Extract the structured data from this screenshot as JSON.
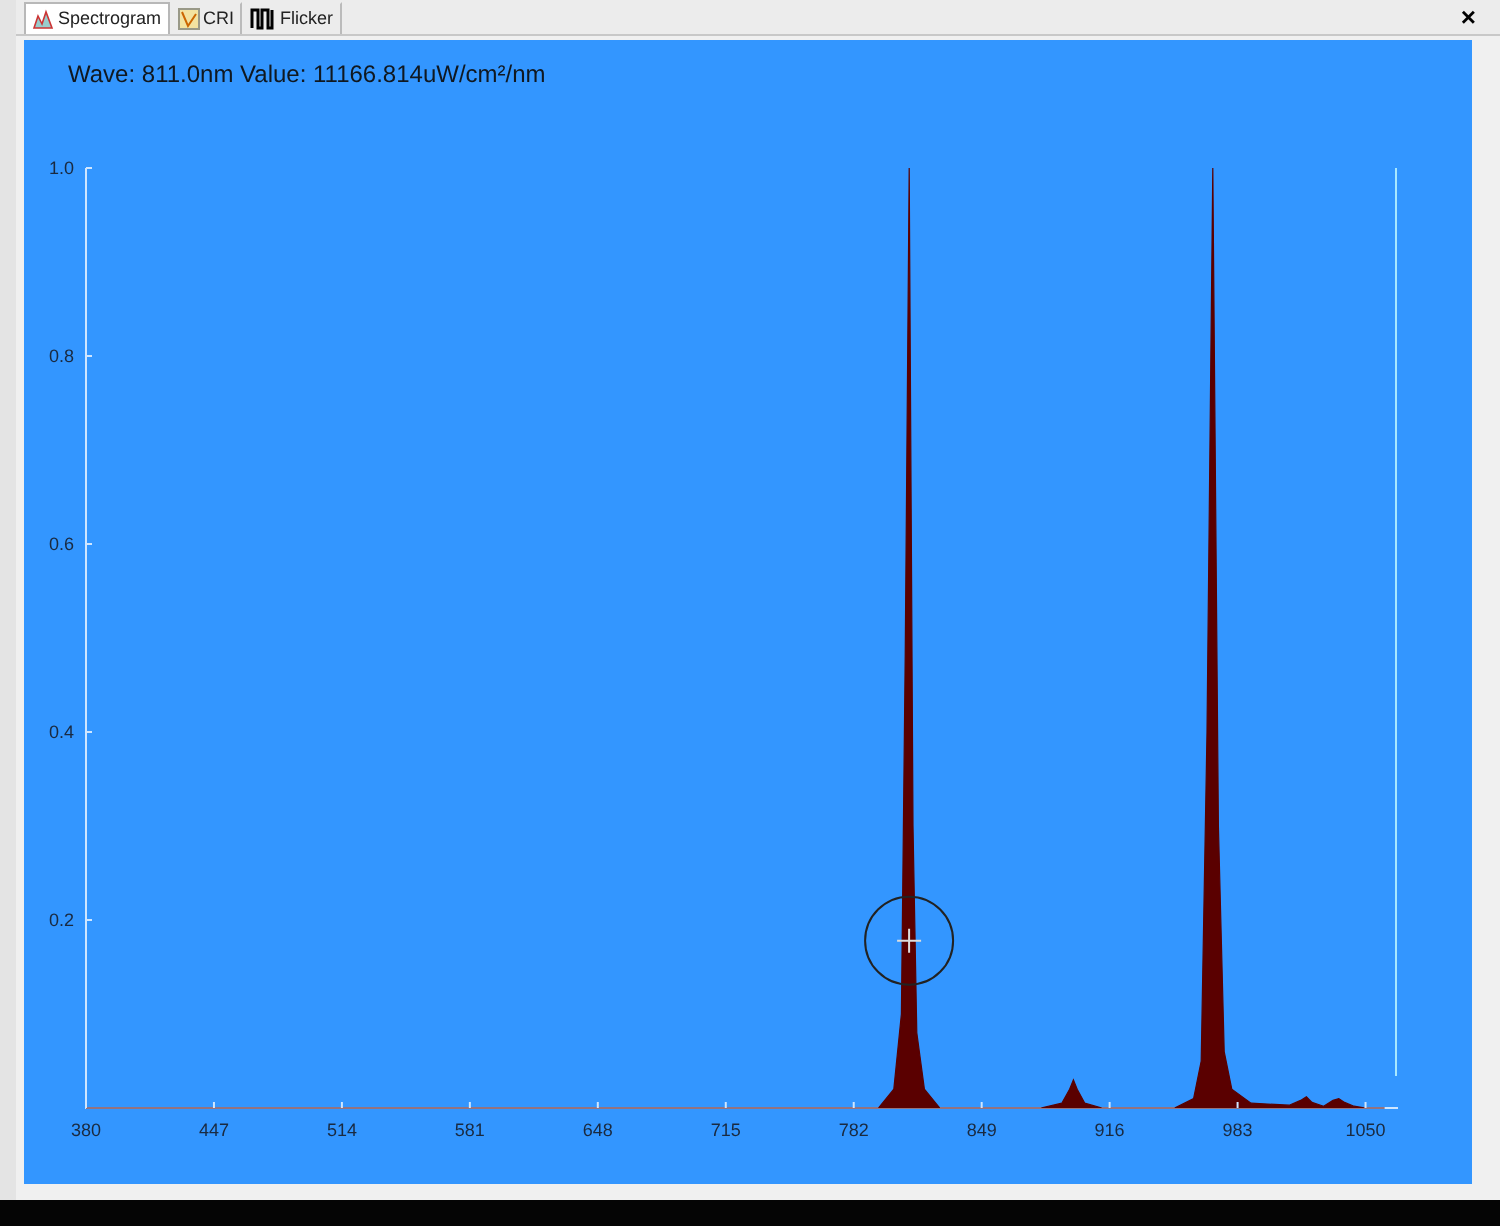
{
  "tabs": [
    {
      "label": "Spectrogram",
      "kind": "spectrum",
      "selected": true
    },
    {
      "label": "CRI",
      "kind": "cri",
      "selected": false
    },
    {
      "label": "Flicker",
      "kind": "flicker",
      "selected": false
    }
  ],
  "close_label": "×",
  "readout": "Wave: 811.0nm Value: 11166.814uW/cm²/nm",
  "chart_data": {
    "type": "area",
    "x": [
      380,
      700,
      795,
      803,
      807,
      809,
      811,
      813,
      815,
      819,
      827,
      880,
      891,
      895,
      897,
      899,
      903,
      912,
      950,
      960,
      964,
      967,
      970,
      973,
      976,
      980,
      990,
      1010,
      1016,
      1019,
      1022,
      1028,
      1033,
      1036,
      1039,
      1044,
      1050,
      1060
    ],
    "series": [
      {
        "color": "#5a0000",
        "values": [
          0,
          0,
          0,
          0.02,
          0.1,
          0.48,
          1.0,
          0.3,
          0.08,
          0.02,
          0,
          0,
          0.005,
          0.02,
          0.03,
          0.02,
          0.005,
          0,
          0,
          0.01,
          0.05,
          0.4,
          1.0,
          0.3,
          0.06,
          0.02,
          0.005,
          0.003,
          0.008,
          0.012,
          0.006,
          0.002,
          0.008,
          0.01,
          0.006,
          0.002,
          0,
          0
        ]
      }
    ],
    "xlim": [
      380,
      1067
    ],
    "ylim": [
      0,
      1
    ],
    "xticks": [
      380,
      447,
      514,
      581,
      648,
      715,
      782,
      849,
      916,
      983,
      1050
    ],
    "yticks": [
      {
        "value": 0.2,
        "label": "0.2"
      },
      {
        "value": 0.4,
        "label": "0.4"
      },
      {
        "value": 0.6,
        "label": "0.6"
      },
      {
        "value": 0.8,
        "label": "0.8"
      },
      {
        "value": 1.0,
        "label": "1.0"
      }
    ]
  }
}
